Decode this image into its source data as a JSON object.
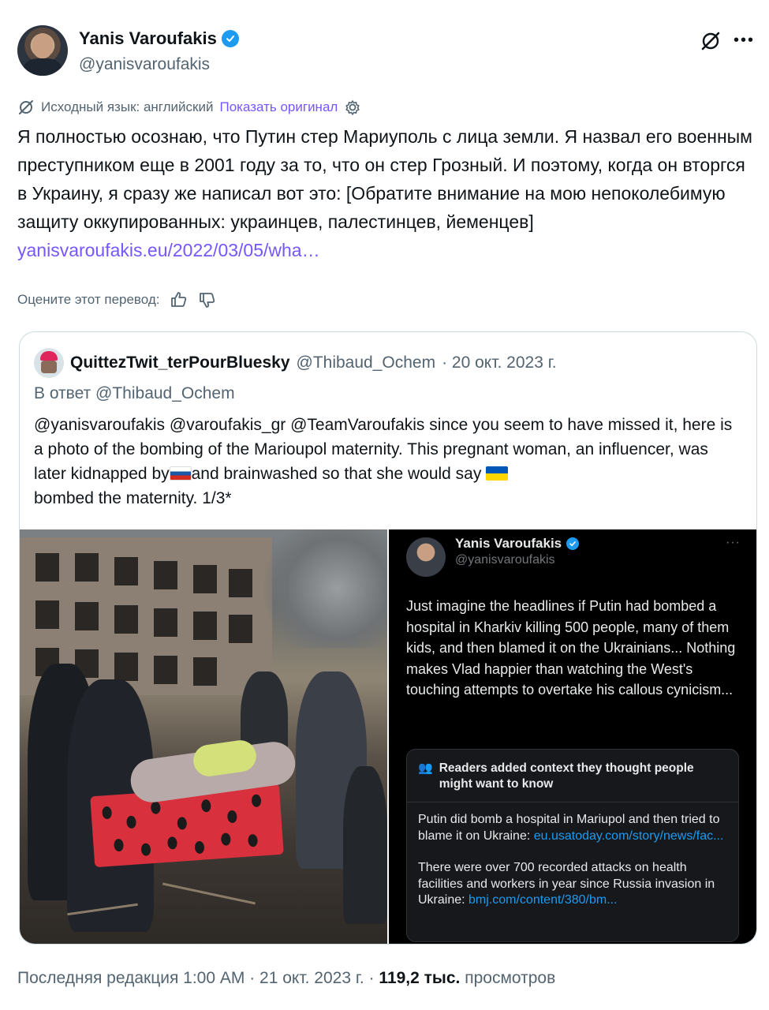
{
  "author": {
    "name": "Yanis Varoufakis",
    "handle": "@yanisvaroufakis"
  },
  "translation": {
    "source_language": "Исходный язык: английский",
    "show_original": "Показать оригинал"
  },
  "tweet": {
    "text": "Я полностью осознаю, что Путин стер Мариуполь с лица земли. Я назвал его военным преступником еще в 2001 году за то, что он стер Грозный. И поэтому, когда он вторгся в Украину, я сразу же написал вот это: [Обратите внимание на мою непоколебимую защиту оккупированных: украинцев, палестинцев, йеменцев]",
    "link": "yanisvaroufakis.eu/2022/03/05/wha…"
  },
  "rate": {
    "label": "Оцените этот перевод:"
  },
  "quote": {
    "name": "QuittezTwit_terPourBluesky",
    "handle": "@Thibaud_Ochem",
    "date": "· 20 окт. 2023 г.",
    "reply_to": "В ответ @Thibaud_Ochem",
    "text_part1": "@yanisvaroufakis @varoufakis_gr @TeamVaroufakis since you seem to have missed it, here is a photo of the bombing of the Marioupol maternity. This pregnant woman, an influencer, was later kidnapped by",
    "text_part2": "and brainwashed so that she would say",
    "text_part3": "bombed the maternity. 1/3*"
  },
  "embedded_screenshot": {
    "name": "Yanis Varoufakis",
    "handle": "@yanisvaroufakis",
    "text": "Just imagine the headlines if Putin had bombed a hospital in Kharkiv killing 500 people, many of them kids, and then blamed it on the Ukrainians... Nothing makes Vlad happier than watching the West's touching attempts to overtake his callous cynicism...",
    "note_header": "Readers added context they thought people might want to know",
    "note_p1": "Putin did bomb a hospital in Mariupol and then tried to blame it on Ukraine: ",
    "note_link1": "eu.usatoday.com/story/news/fac...",
    "note_p2": "There were over 700 recorded attacks on health facilities and workers in year since Russia invasion in Ukraine: ",
    "note_link2": "bmj.com/content/380/bm..."
  },
  "footer": {
    "edited": "Последняя редакция 1:00 AM · 21 окт. 2023 г. · ",
    "views_count": "119,2 тыс.",
    "views_label": " просмотров"
  },
  "colors": {
    "verified": "#1d9bf0",
    "translation_link": "#7856ff",
    "secondary_text": "#536471"
  },
  "icons": [
    "verified-badge-icon",
    "grok-icon",
    "more-icon",
    "translate-icon",
    "settings-icon",
    "thumbs-up-icon",
    "thumbs-down-icon",
    "people-icon"
  ]
}
